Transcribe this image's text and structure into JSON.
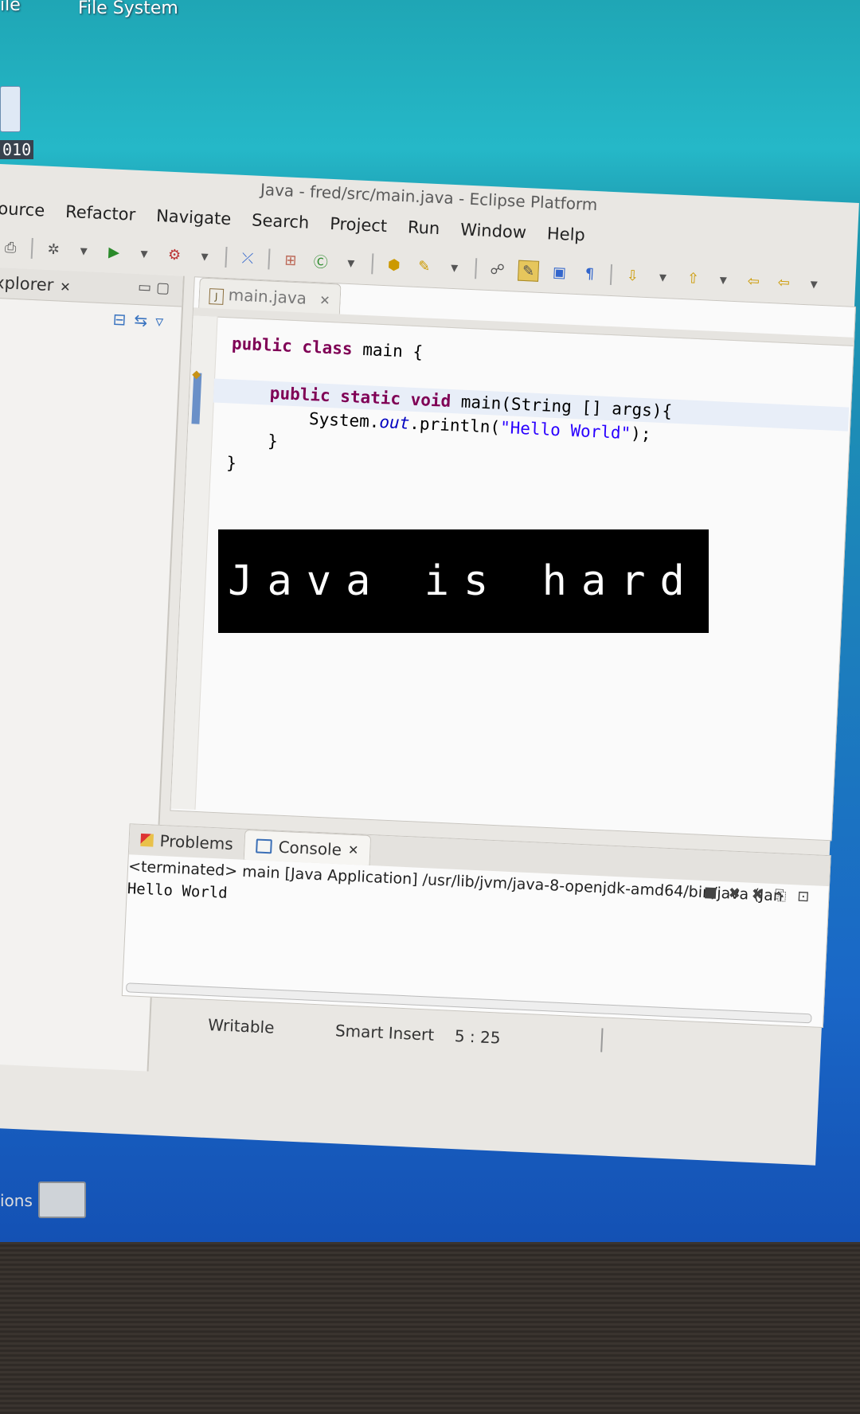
{
  "desktop": {
    "corner_text": "ile",
    "file_system_label": "File System",
    "counter_text": "010"
  },
  "window": {
    "title": "Java - fred/src/main.java - Eclipse Platform"
  },
  "menu": [
    "ource",
    "Refactor",
    "Navigate",
    "Search",
    "Project",
    "Run",
    "Window",
    "Help"
  ],
  "explorer": {
    "title": "xplorer"
  },
  "editor": {
    "tab_label": "main.java",
    "code": {
      "line1_kw": "public class",
      "line1_rest": " main {",
      "line2_kw": "public static void",
      "line2_rest": " main(String [] args){",
      "line3_pre": "System.",
      "line3_field": "out",
      "line3_mid": ".println(",
      "line3_str": "\"Hello World\"",
      "line3_end": ");",
      "line4": "}",
      "line5": "}"
    }
  },
  "overlay_text": "Java is hard",
  "console": {
    "tab_problems": "Problems",
    "tab_console": "Console",
    "status_line": "<terminated> main [Java Application] /usr/lib/jvm/java-8-openjdk-amd64/bin/java (Jan",
    "output": "Hello World"
  },
  "statusbar": {
    "writable": "Writable",
    "insert_mode": "Smart Insert",
    "position": "5 : 25"
  },
  "taskbar": {
    "label": "ions"
  }
}
